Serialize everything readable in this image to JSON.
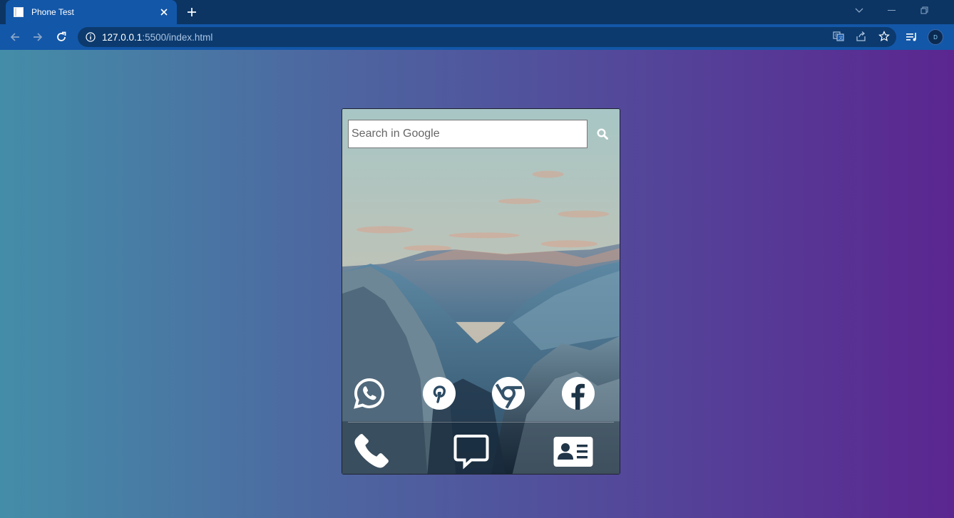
{
  "browser": {
    "tab_title": "Phone Test",
    "url_host": "127.0.0.1",
    "url_rest": ":5500/index.html",
    "profile_initial": "D"
  },
  "phone": {
    "search_placeholder": "Search in Google",
    "apps": [
      "whatsapp",
      "pinterest",
      "chrome",
      "facebook"
    ],
    "dock": [
      "phone",
      "messages",
      "contacts"
    ]
  },
  "colors": {
    "tab_active": "#1357a8",
    "tabbar": "#0c3563",
    "gradient_left": "#448da8",
    "gradient_right": "#5b2690"
  }
}
